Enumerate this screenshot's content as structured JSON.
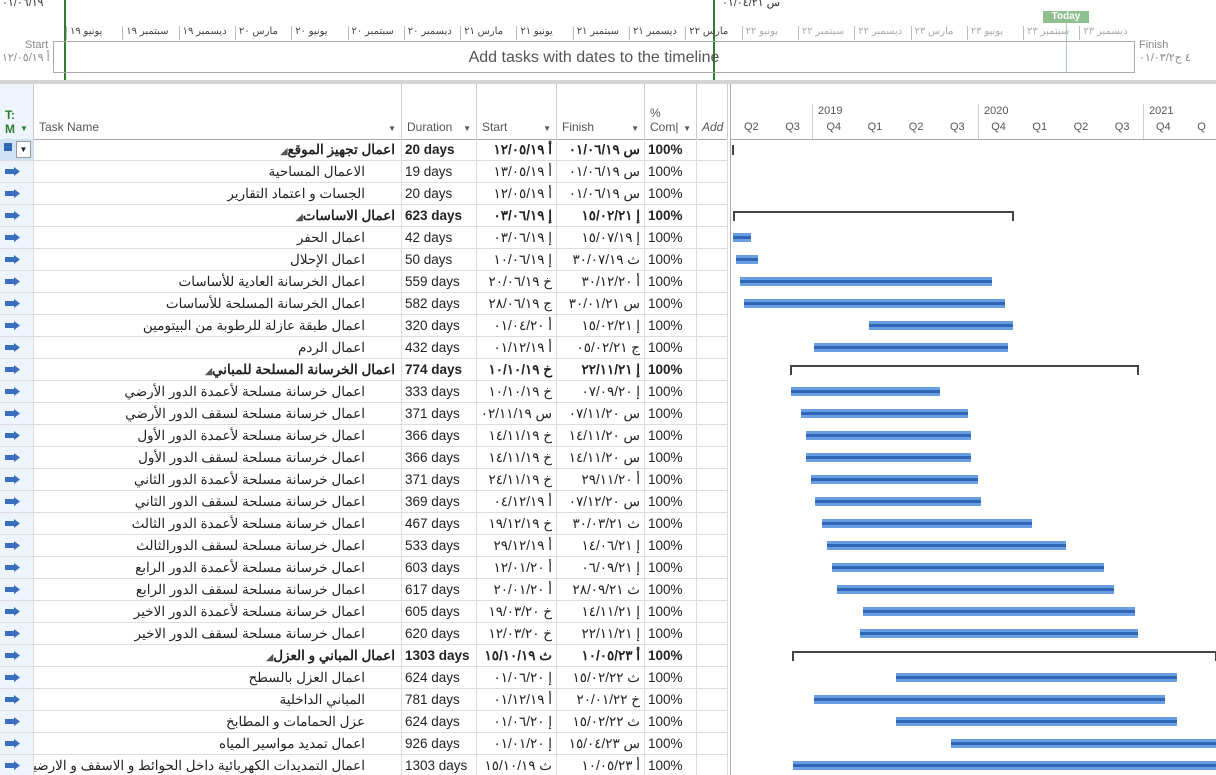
{
  "timeline": {
    "top_left_date": "۰۱/۰٦/۱۹",
    "top_right_date": "۰۱/۰٤/۲۱ س",
    "months": [
      "يونيو ١٩",
      "سبتمبر ١٩",
      "ديسمبر ١٩",
      "مارس ٢٠",
      "يونيو ٢٠",
      "سبتمبر ٢٠",
      "ديسمبر ٢٠",
      "مارس ٢١",
      "يونيو ٢١",
      "سبتمبر ٢١",
      "ديسمبر ٢١",
      "مارس ٢٢",
      "يونيو ٢٢",
      "سبتمبر ٢٢",
      "ديسمبر ٢٢",
      "مارس ٢٣",
      "يونيو ٢٣",
      "سبتمبر ٢٣",
      "ديسمبر ٢٣"
    ],
    "today_label": "Today",
    "placeholder": "Add tasks with dates to the timeline",
    "start_label": "Start",
    "start_date": "۱۲/۰٥/۱۹ أ",
    "finish_label": "Finish",
    "finish_date": "۰۱/۰۳/۲٤ ج"
  },
  "columns": {
    "mode_line1": "T:",
    "mode_line2": "M",
    "task_name": "Task Name",
    "duration": "Duration",
    "start": "Start",
    "finish": "Finish",
    "pct_line1": "%",
    "pct_line2": "Com|",
    "add": "Add"
  },
  "gantt_header": {
    "years": [
      "2019",
      "2020",
      "2021"
    ],
    "quarters": [
      "Q2",
      "Q3",
      "Q4",
      "Q1",
      "Q2",
      "Q3",
      "Q4",
      "Q1",
      "Q2",
      "Q3",
      "Q4",
      "Q"
    ]
  },
  "tasks": [
    {
      "name": "اعمال تجهيز الموقع",
      "duration": "20 days",
      "start": "أ ١٢/٠٥/١٩",
      "finish": "س ٠١/٠٦/١٩",
      "pct": "100%",
      "summary": true,
      "bar": {
        "type": "summary",
        "s": 1,
        "e": 2
      }
    },
    {
      "name": "الاعمال المساحية",
      "duration": "19 days",
      "start": "أ ١٣/٠٥/١٩",
      "finish": "س ٠١/٠٦/١٩",
      "pct": "100%",
      "summary": false,
      "bar": null
    },
    {
      "name": "الجسات و اعتماد التقارير",
      "duration": "20 days",
      "start": "أ ١٢/٠٥/١٩",
      "finish": "س ٠١/٠٦/١٩",
      "pct": "100%",
      "summary": false,
      "bar": null
    },
    {
      "name": "اعمال الاساسات",
      "duration": "623 days",
      "start": "إ ٠٣/٠٦/١٩",
      "finish": "إ ١٥/٠٢/٢١",
      "pct": "100%",
      "summary": true,
      "bar": {
        "type": "summary",
        "s": 2,
        "e": 283
      }
    },
    {
      "name": "اعمال الحفر",
      "duration": "42 days",
      "start": "إ ٠٣/٠٦/١٩",
      "finish": "إ ١٥/٠٧/١٩",
      "pct": "100%",
      "summary": false,
      "bar": {
        "type": "task",
        "s": 2,
        "e": 20
      }
    },
    {
      "name": "اعمال الإحلال",
      "duration": "50 days",
      "start": "إ ١٠/٠٦/١٩",
      "finish": "ث ٣٠/٠٧/١٩",
      "pct": "100%",
      "summary": false,
      "bar": {
        "type": "task",
        "s": 5,
        "e": 27
      }
    },
    {
      "name": "اعمال الخرسانة العادية للأساسات",
      "duration": "559 days",
      "start": "خ ٢٠/٠٦/١٩",
      "finish": "أ ٣٠/١٢/٢٠",
      "pct": "100%",
      "summary": false,
      "bar": {
        "type": "task",
        "s": 9,
        "e": 261
      }
    },
    {
      "name": "اعمال الخرسانة المسلحة للأساسات",
      "duration": "582 days",
      "start": "ج ٢٨/٠٦/١٩",
      "finish": "س ٣٠/٠١/٢١",
      "pct": "100%",
      "summary": false,
      "bar": {
        "type": "task",
        "s": 13,
        "e": 274
      }
    },
    {
      "name": "اعمال طبقة عازلة للرطوبة من البيتومين",
      "duration": "320 days",
      "start": "أ ٠١/٠٤/٢٠",
      "finish": "إ ١٥/٠٢/٢١",
      "pct": "100%",
      "summary": false,
      "bar": {
        "type": "task",
        "s": 138,
        "e": 282
      }
    },
    {
      "name": "اعمال الردم",
      "duration": "432 days",
      "start": "أ ٠١/١٢/١٩",
      "finish": "ج ٠٥/٠٢/٢١",
      "pct": "100%",
      "summary": false,
      "bar": {
        "type": "task",
        "s": 83,
        "e": 277
      }
    },
    {
      "name": "اعمال الخرسانة المسلحة للمباني",
      "duration": "774 days",
      "start": "خ ١٠/١٠/١٩",
      "finish": "إ ٢٢/١١/٢١",
      "pct": "100%",
      "summary": true,
      "bar": {
        "type": "summary",
        "s": 59,
        "e": 408
      }
    },
    {
      "name": "اعمال خرسانة مسلحة لأعمدة الدور الأرضي",
      "duration": "333 days",
      "start": "خ ١٠/١٠/١٩",
      "finish": "إ ٠٧/٠٩/٢٠",
      "pct": "100%",
      "summary": false,
      "bar": {
        "type": "task",
        "s": 60,
        "e": 209
      }
    },
    {
      "name": "اعمال خرسانة مسلحة لسقف الدور الأرضي",
      "duration": "371 days",
      "start": "س ٠٢/١١/١٩",
      "finish": "س ٠٧/١١/٢٠",
      "pct": "100%",
      "summary": false,
      "bar": {
        "type": "task",
        "s": 70,
        "e": 237
      }
    },
    {
      "name": "اعمال خرسانة مسلحة لأعمدة الدور الأول",
      "duration": "366 days",
      "start": "خ ١٤/١١/١٩",
      "finish": "س ١٤/١١/٢٠",
      "pct": "100%",
      "summary": false,
      "bar": {
        "type": "task",
        "s": 75,
        "e": 240
      }
    },
    {
      "name": "اعمال خرسانة مسلحة لسقف الدور الأول",
      "duration": "366 days",
      "start": "خ ١٤/١١/١٩",
      "finish": "س ١٤/١١/٢٠",
      "pct": "100%",
      "summary": false,
      "bar": {
        "type": "task",
        "s": 75,
        "e": 240
      }
    },
    {
      "name": "اعمال خرسانة مسلحة لأعمدة الدور الثاني",
      "duration": "371 days",
      "start": "خ ٢٤/١١/١٩",
      "finish": "أ ٢٩/١١/٢٠",
      "pct": "100%",
      "summary": false,
      "bar": {
        "type": "task",
        "s": 80,
        "e": 247
      }
    },
    {
      "name": "اعمال خرسانة مسلحة لسقف الدور الثاني",
      "duration": "369 days",
      "start": "أ ٠٤/١٢/١٩",
      "finish": "س ٠٧/١٢/٢٠",
      "pct": "100%",
      "summary": false,
      "bar": {
        "type": "task",
        "s": 84,
        "e": 250
      }
    },
    {
      "name": "اعمال خرسانة مسلحة لأعمدة الدور الثالث",
      "duration": "467 days",
      "start": "خ ١٩/١٢/١٩",
      "finish": "ث ٣٠/٠٣/٢١",
      "pct": "100%",
      "summary": false,
      "bar": {
        "type": "task",
        "s": 91,
        "e": 301
      }
    },
    {
      "name": "اعمال خرسانة مسلحة لسقف الدورالثالث",
      "duration": "533 days",
      "start": "أ ٢٩/١٢/١٩",
      "finish": "إ ١٤/٠٦/٢١",
      "pct": "100%",
      "summary": false,
      "bar": {
        "type": "task",
        "s": 96,
        "e": 335
      }
    },
    {
      "name": "اعمال خرسانة مسلحة لأعمدة الدور الرابع",
      "duration": "603 days",
      "start": "أ ١٢/٠١/٢٠",
      "finish": "إ ٠٦/٠٩/٢١",
      "pct": "100%",
      "summary": false,
      "bar": {
        "type": "task",
        "s": 101,
        "e": 373
      }
    },
    {
      "name": "اعمال خرسانة مسلحة لسقف الدور الرابع",
      "duration": "617 days",
      "start": "أ ٢٠/٠١/٢٠",
      "finish": "ث ٢٨/٠٩/٢١",
      "pct": "100%",
      "summary": false,
      "bar": {
        "type": "task",
        "s": 106,
        "e": 383
      }
    },
    {
      "name": "اعمال خرسانة مسلحة لأعمدة الدور الاخير",
      "duration": "605 days",
      "start": "خ ١٩/٠٣/٢٠",
      "finish": "إ ١٤/١١/٢١",
      "pct": "100%",
      "summary": false,
      "bar": {
        "type": "task",
        "s": 132,
        "e": 404
      }
    },
    {
      "name": "اعمال خرسانة مسلحة لسقف الدور الاخير",
      "duration": "620 days",
      "start": "خ ١٢/٠٣/٢٠",
      "finish": "إ ٢٢/١١/٢١",
      "pct": "100%",
      "summary": false,
      "bar": {
        "type": "task",
        "s": 129,
        "e": 407
      }
    },
    {
      "name": "اعمال المباني و العزل",
      "duration": "1303 days",
      "start": "ث ١٥/١٠/١٩",
      "finish": "أ ١٠/٠٥/٢٣",
      "pct": "100%",
      "summary": true,
      "bar": {
        "type": "summary",
        "s": 61,
        "e": 486
      }
    },
    {
      "name": "اعمال العزل بالسطح",
      "duration": "624 days",
      "start": "إ ٠١/٠٦/٢٠",
      "finish": "ث ١٥/٠٢/٢٢",
      "pct": "100%",
      "summary": false,
      "bar": {
        "type": "task",
        "s": 165,
        "e": 446
      }
    },
    {
      "name": "المباني الداخلية",
      "duration": "781 days",
      "start": "أ ٠١/١٢/١٩",
      "finish": "خ ٢٠/٠١/٢٢",
      "pct": "100%",
      "summary": false,
      "bar": {
        "type": "task",
        "s": 83,
        "e": 434
      }
    },
    {
      "name": "عزل الحمامات و المطابخ",
      "duration": "624 days",
      "start": "إ ٠١/٠٦/٢٠",
      "finish": "ث ١٥/٠٢/٢٢",
      "pct": "100%",
      "summary": false,
      "bar": {
        "type": "task",
        "s": 165,
        "e": 446
      }
    },
    {
      "name": "اعمال تمديد مواسير المياه",
      "duration": "926 days",
      "start": "إ ٠١/٠١/٢٠",
      "finish": "س ١٥/٠٤/٢٣",
      "pct": "100%",
      "summary": false,
      "bar": {
        "type": "task",
        "s": 220,
        "e": 486
      }
    },
    {
      "name": "اعمال التمديدات الكهربائية داخل الحوائط و الاسقف و الارضيات",
      "duration": "1303 days",
      "start": "ث ١٥/١٠/١٩",
      "finish": "أ ١٠/٠٥/٢٣",
      "pct": "100%",
      "summary": false,
      "bar": {
        "type": "task",
        "s": 62,
        "e": 486
      }
    }
  ]
}
